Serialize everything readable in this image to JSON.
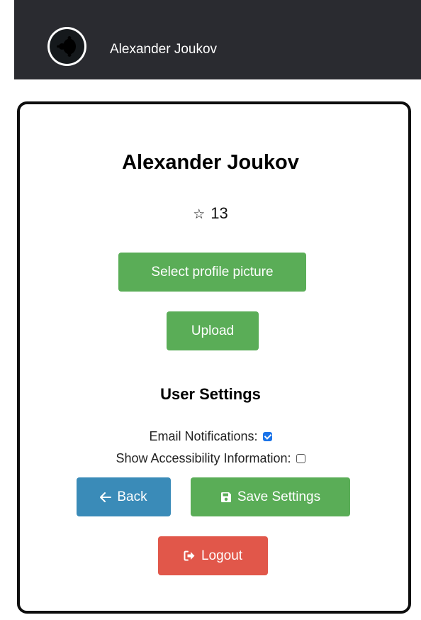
{
  "navbar": {
    "user_name": "Alexander Joukov",
    "background": "#2a2b30"
  },
  "profile": {
    "name": "Alexander Joukov",
    "star_icon": "☆",
    "rating": "13"
  },
  "buttons": {
    "select_picture": "Select profile picture",
    "upload": "Upload",
    "back": "Back",
    "save_settings": "Save Settings",
    "logout": "Logout"
  },
  "settings": {
    "heading": "User Settings",
    "email_notifications": {
      "label": "Email Notifications:",
      "checked": true
    },
    "show_accessibility": {
      "label": "Show Accessibility Information:",
      "checked": false
    }
  },
  "colors": {
    "green": "#5aad57",
    "blue": "#3a8bb8",
    "red": "#e1574a",
    "checkbox_checked": "#1a73e8"
  },
  "icons": {
    "avatar": "avatar-fractal-icon",
    "back": "arrow-left-icon",
    "save": "floppy-disk-icon",
    "logout": "sign-out-icon"
  }
}
